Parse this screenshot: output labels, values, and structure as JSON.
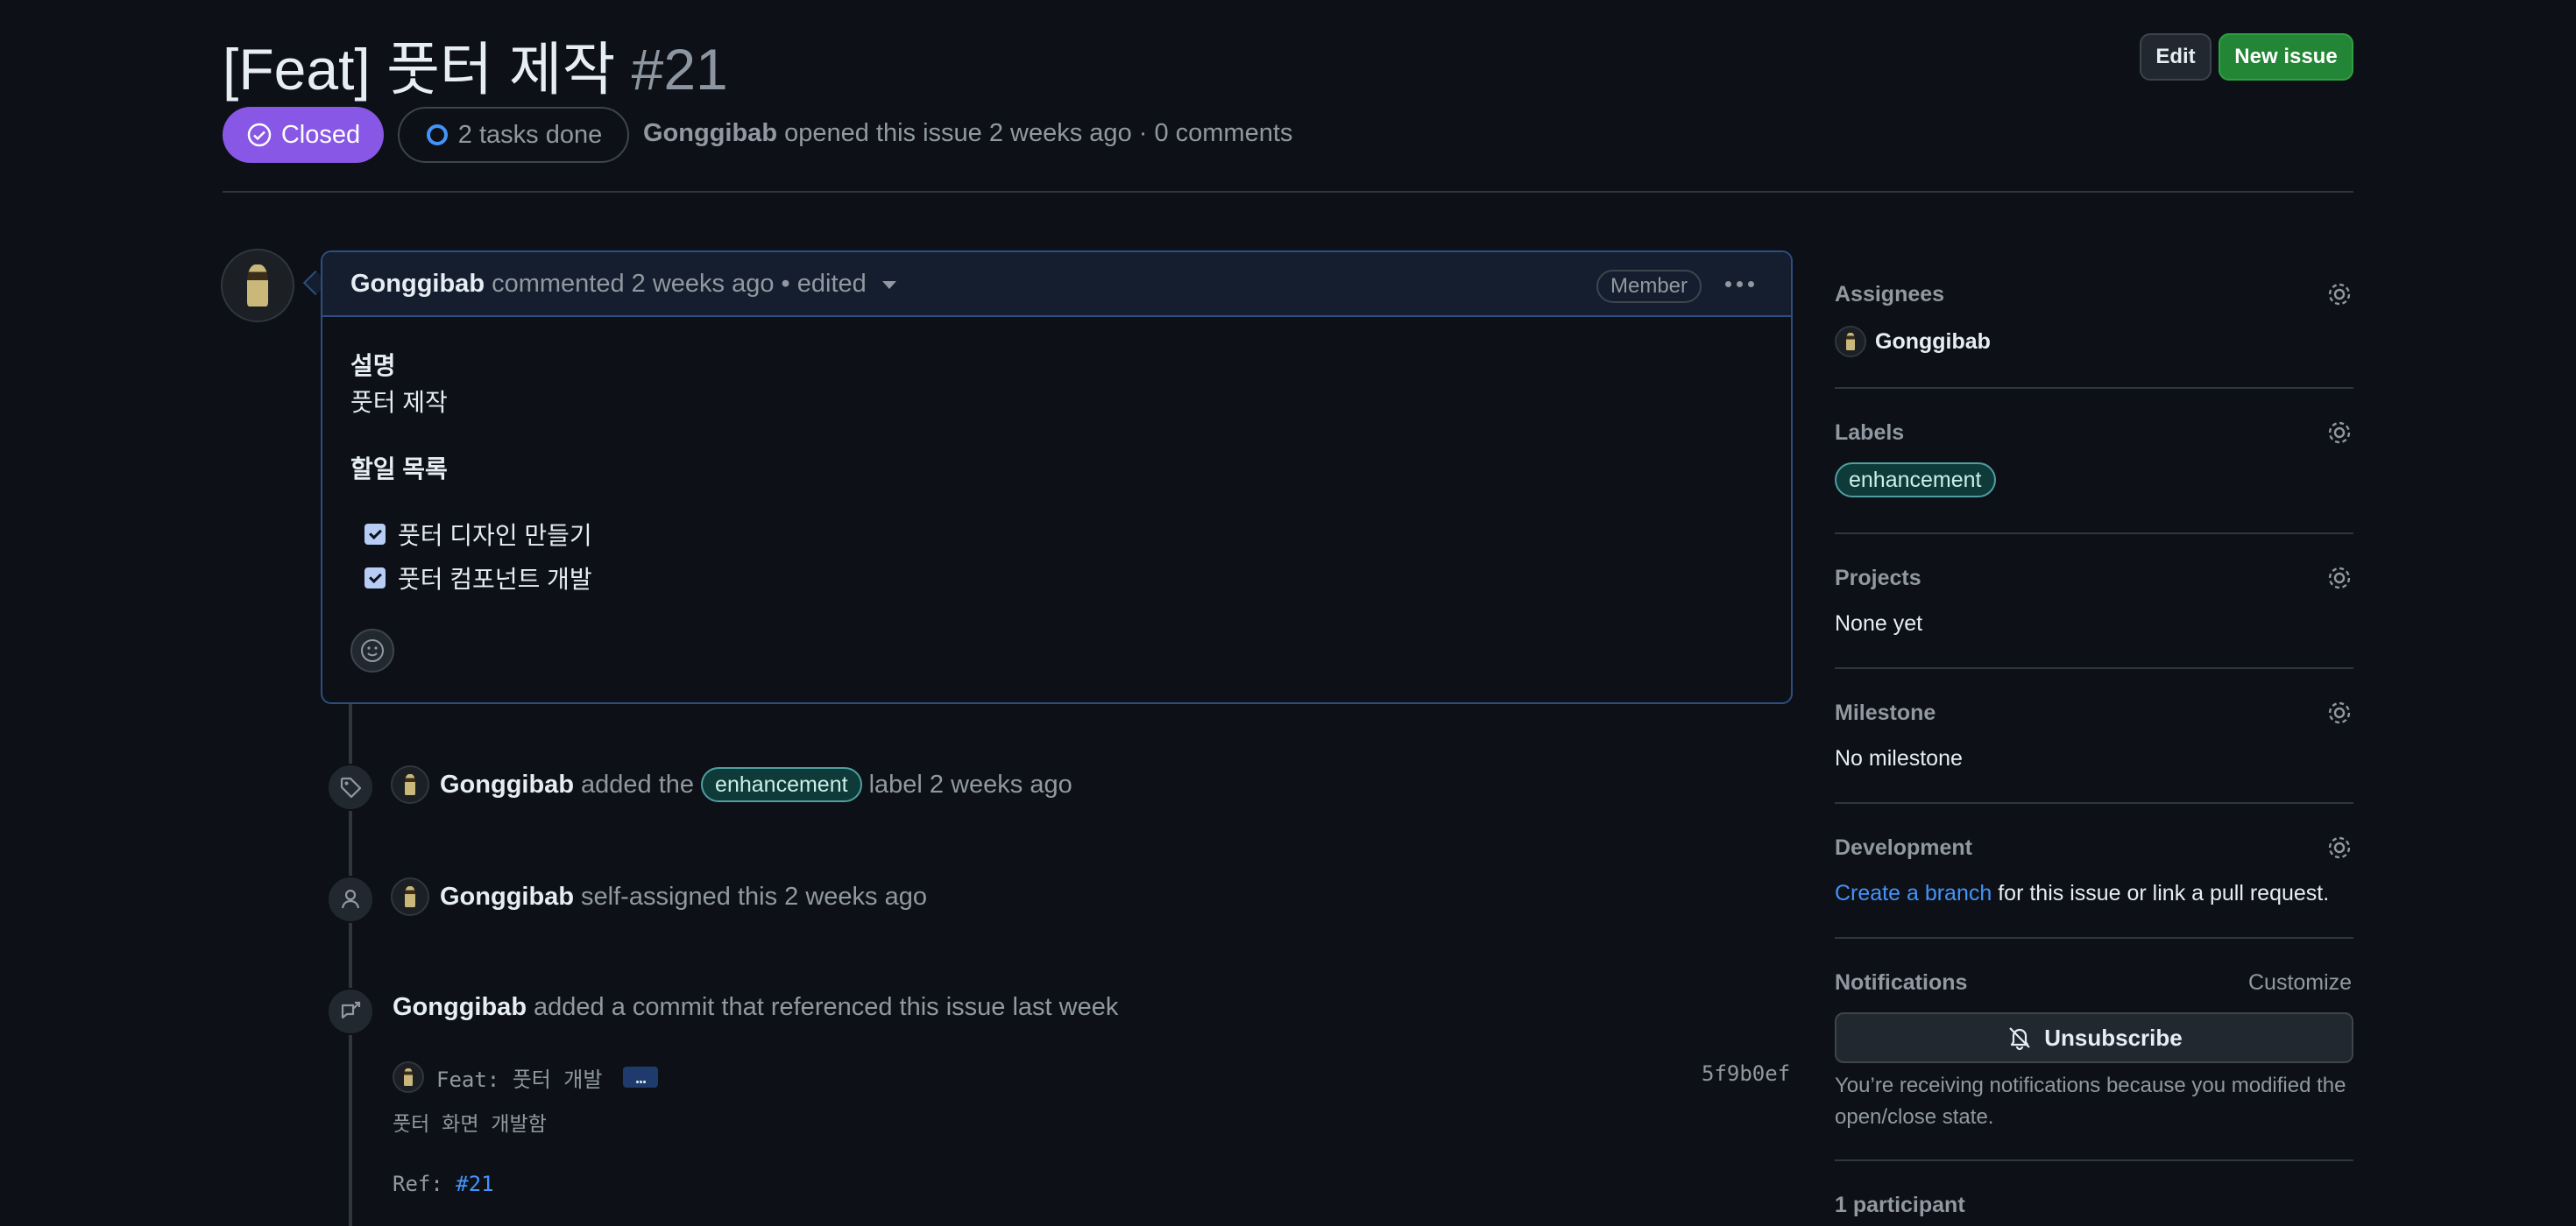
{
  "issue": {
    "title": "[Feat] 풋터 제작",
    "number": "#21",
    "state": "Closed",
    "tasks": "2 tasks done",
    "author": "Gonggibab",
    "meta_rest": "opened this issue 2 weeks ago · 0 comments"
  },
  "header_buttons": {
    "edit": "Edit",
    "new_issue": "New issue"
  },
  "comment": {
    "author": "Gonggibab",
    "meta": "commented 2 weeks ago • edited",
    "role": "Member",
    "heading1": "설명",
    "para1": "풋터 제작",
    "heading2": "할일 목록",
    "tasks": [
      "풋터 디자인 만들기",
      "풋터 컴포넌트 개발"
    ]
  },
  "timeline": {
    "label_event": {
      "actor": "Gonggibab",
      "pre": "added the",
      "label": "enhancement",
      "post": "label 2 weeks ago"
    },
    "assign_event": {
      "actor": "Gonggibab",
      "text": "self-assigned this 2 weeks ago"
    },
    "commit_event": {
      "actor": "Gonggibab",
      "text": "added a commit that referenced this issue last week",
      "commit_title": "Feat: 풋터 개발",
      "ellipsis": "…",
      "sha": "5f9b0ef",
      "description": "풋터 화면 개발함",
      "ref_prefix": "Ref:",
      "ref_link": "#21"
    }
  },
  "sidebar": {
    "assignees": {
      "title": "Assignees",
      "value": "Gonggibab"
    },
    "labels": {
      "title": "Labels",
      "value": "enhancement"
    },
    "projects": {
      "title": "Projects",
      "value": "None yet"
    },
    "milestone": {
      "title": "Milestone",
      "value": "No milestone"
    },
    "development": {
      "title": "Development",
      "link": "Create a branch",
      "rest": "for this issue or link a pull request."
    },
    "notifications": {
      "title": "Notifications",
      "customize": "Customize",
      "button": "Unsubscribe",
      "note": "You’re receiving notifications because you modified the open/close state."
    },
    "participants": "1 participant"
  },
  "colors": {
    "closed": "#8957e5",
    "accent": "#4493f8",
    "primary_button": "#238636",
    "label": "#0e3a3a"
  }
}
